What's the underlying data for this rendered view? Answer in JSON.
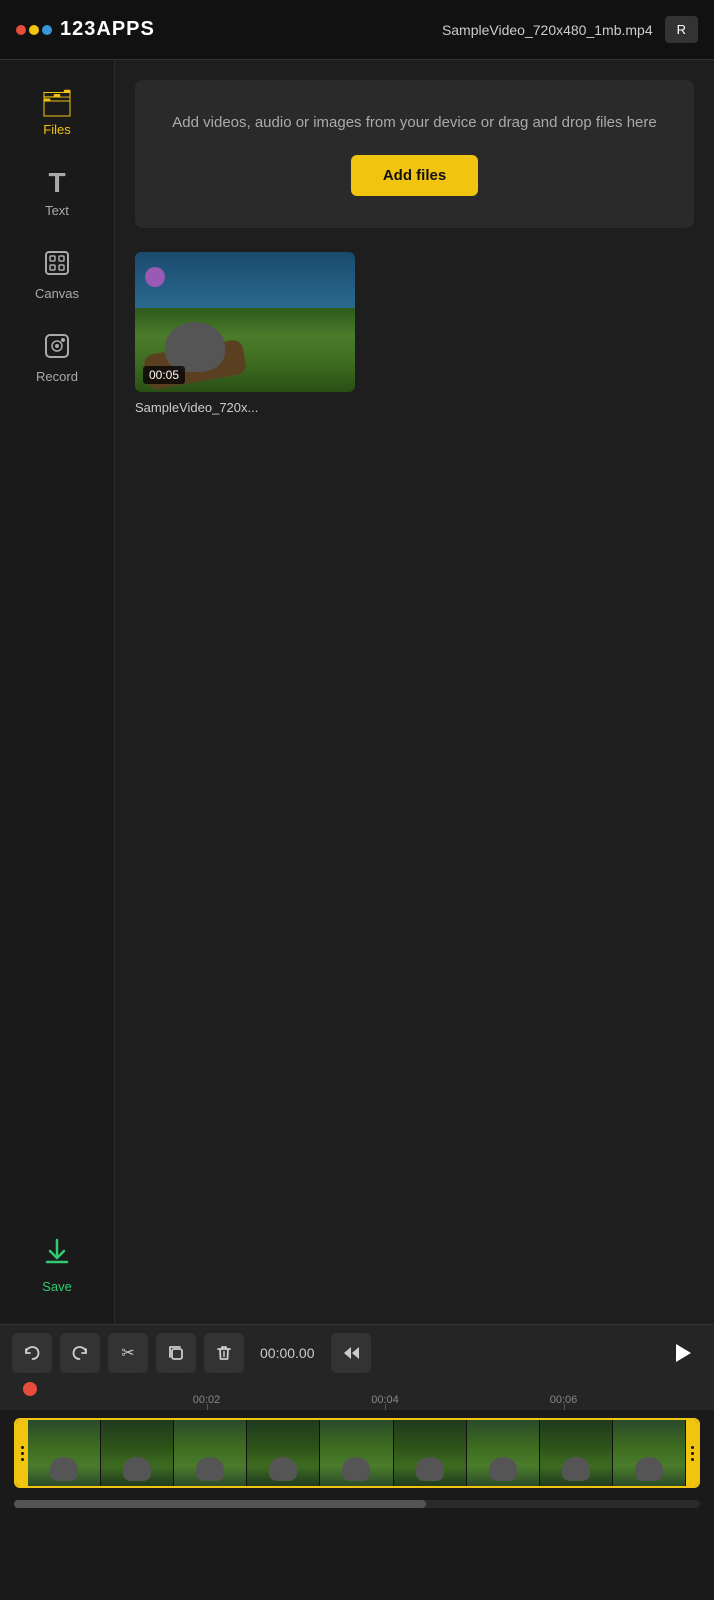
{
  "header": {
    "app_name": "123APPS",
    "file_name": "SampleVideo_720x480_1mb.mp4",
    "export_btn": "R"
  },
  "sidebar": {
    "items": [
      {
        "id": "files",
        "label": "Files",
        "icon": "📁",
        "active": true
      },
      {
        "id": "text",
        "label": "Text",
        "icon": "T",
        "active": false
      },
      {
        "id": "canvas",
        "label": "Canvas",
        "icon": "⊞",
        "active": false
      },
      {
        "id": "record",
        "label": "Record",
        "icon": "⊙",
        "active": false
      }
    ],
    "save_label": "Save"
  },
  "upload": {
    "text": "Add videos, audio or images from your device or drag and drop files here",
    "btn_label": "Add files"
  },
  "file_item": {
    "duration": "00:05",
    "name": "SampleVideo_720x..."
  },
  "toolbar": {
    "undo_label": "↩",
    "redo_label": "↪",
    "cut_label": "✂",
    "copy_label": "⧉",
    "delete_label": "🗑",
    "time_display": "00:00.00",
    "rewind_label": "⏮",
    "play_label": "▶"
  },
  "timeline": {
    "markers": [
      "00:02",
      "00:04",
      "00:06"
    ],
    "marker_positions": [
      25,
      50,
      75
    ],
    "frame_count": 9
  }
}
